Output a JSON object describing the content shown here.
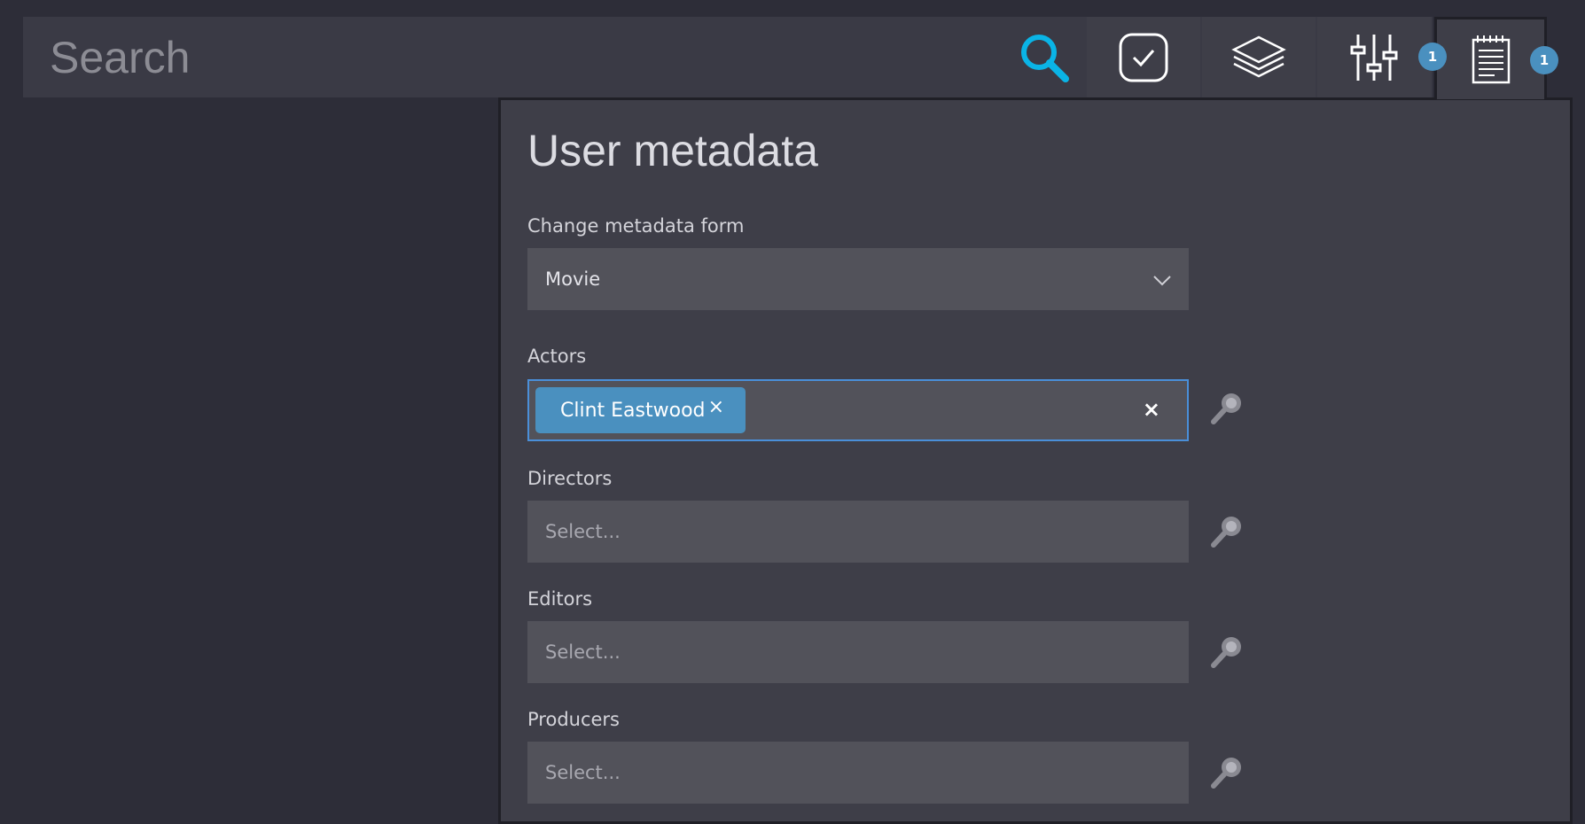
{
  "search": {
    "placeholder": "Search"
  },
  "toolbar": {
    "search_icon": "search-icon",
    "buttons": [
      {
        "name": "check-icon"
      },
      {
        "name": "layers-icon"
      },
      {
        "name": "sliders-icon",
        "badge": "1"
      },
      {
        "name": "notepad-icon",
        "badge": "1"
      }
    ],
    "accent_color": "#0ab4e6",
    "badge_color": "#4a90bf"
  },
  "panel": {
    "title": "User metadata",
    "form_select": {
      "label": "Change metadata form",
      "value": "Movie"
    },
    "fields": [
      {
        "label": "Actors",
        "tags": [
          "Clint Eastwood"
        ],
        "tag_remove": "×",
        "clear": "×"
      },
      {
        "label": "Directors",
        "placeholder": "Select..."
      },
      {
        "label": "Editors",
        "placeholder": "Select..."
      },
      {
        "label": "Producers",
        "placeholder": "Select..."
      }
    ]
  }
}
